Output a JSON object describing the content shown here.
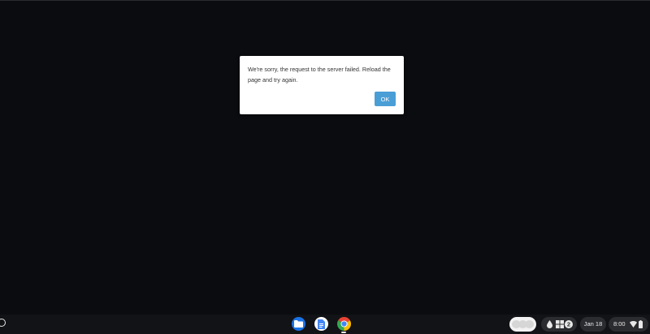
{
  "dialog": {
    "message": "We're sorry, the request to the server failed. Reload the page and try again.",
    "ok_label": "OK"
  },
  "shelf": {
    "apps": [
      {
        "name": "Files",
        "icon": "files-icon",
        "running": false
      },
      {
        "name": "Google Docs",
        "icon": "docs-icon",
        "running": false
      },
      {
        "name": "Google Chrome",
        "icon": "chrome-icon",
        "running": true
      }
    ],
    "date": "Jan 18",
    "time": "8:00",
    "notification_count": "2"
  },
  "colors": {
    "background": "#0b0c0f",
    "button_accent": "#4a9ed6",
    "shelf": "#121316"
  }
}
